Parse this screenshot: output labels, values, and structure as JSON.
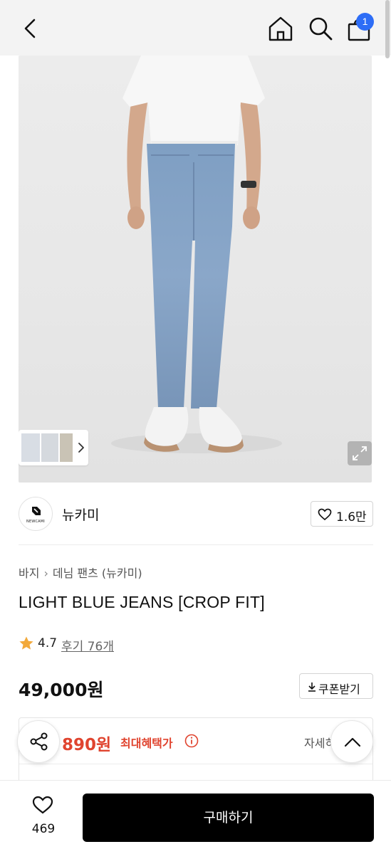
{
  "header": {
    "back_icon": "chevron-left-icon",
    "home_icon": "home-icon",
    "search_icon": "search-icon",
    "cart_icon": "shopping-bag-icon",
    "cart_badge": "1",
    "badge_color": "#2d6df6"
  },
  "gallery": {
    "expand_icon": "expand-icon",
    "thumbnail_next_icon": "chevron-right-icon"
  },
  "brand": {
    "logo_text": "NEWCAMI",
    "name": "뉴카미",
    "like_count": "1.6만"
  },
  "breadcrumb": {
    "items": [
      "바지",
      "데님 팬츠 (뉴카미)"
    ]
  },
  "product": {
    "title": "LIGHT BLUE JEANS [CROP FIT]",
    "rating": "4.7",
    "reviews_label": "후기 76개",
    "price": "49,000원",
    "coupon_label": "쿠폰받기"
  },
  "benefit": {
    "max_price": "890원",
    "max_label": "최대혜택가",
    "detail_label": "자세히",
    "accent_color": "#e0442f"
  },
  "bottom": {
    "wish_count": "469",
    "buy_label": "구매하기"
  }
}
